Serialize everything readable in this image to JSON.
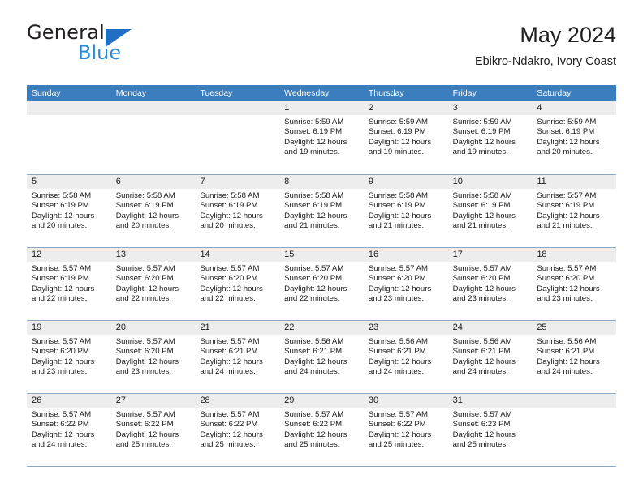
{
  "brand": {
    "line1": "General",
    "line2": "Blue",
    "triangle_color": "#1f6fc4",
    "blue_text_color": "#2b8ad6"
  },
  "header": {
    "title": "May 2024",
    "subtitle": "Ebikro-Ndakro, Ivory Coast"
  },
  "theme": {
    "header_bg": "#3b7ebf",
    "header_text": "#ffffff",
    "daynum_bg": "#ededed",
    "grid_line": "#8aa8c4",
    "page_bg": "#ffffff",
    "text": "#1a1a1a"
  },
  "weekdays": [
    "Sunday",
    "Monday",
    "Tuesday",
    "Wednesday",
    "Thursday",
    "Friday",
    "Saturday"
  ],
  "weeks": [
    [
      {
        "day": "",
        "empty": true
      },
      {
        "day": "",
        "empty": true
      },
      {
        "day": "",
        "empty": true
      },
      {
        "day": "1",
        "sunrise": "Sunrise: 5:59 AM",
        "sunset": "Sunset: 6:19 PM",
        "daylight": "Daylight: 12 hours and 19 minutes."
      },
      {
        "day": "2",
        "sunrise": "Sunrise: 5:59 AM",
        "sunset": "Sunset: 6:19 PM",
        "daylight": "Daylight: 12 hours and 19 minutes."
      },
      {
        "day": "3",
        "sunrise": "Sunrise: 5:59 AM",
        "sunset": "Sunset: 6:19 PM",
        "daylight": "Daylight: 12 hours and 19 minutes."
      },
      {
        "day": "4",
        "sunrise": "Sunrise: 5:59 AM",
        "sunset": "Sunset: 6:19 PM",
        "daylight": "Daylight: 12 hours and 20 minutes."
      }
    ],
    [
      {
        "day": "5",
        "sunrise": "Sunrise: 5:58 AM",
        "sunset": "Sunset: 6:19 PM",
        "daylight": "Daylight: 12 hours and 20 minutes."
      },
      {
        "day": "6",
        "sunrise": "Sunrise: 5:58 AM",
        "sunset": "Sunset: 6:19 PM",
        "daylight": "Daylight: 12 hours and 20 minutes."
      },
      {
        "day": "7",
        "sunrise": "Sunrise: 5:58 AM",
        "sunset": "Sunset: 6:19 PM",
        "daylight": "Daylight: 12 hours and 20 minutes."
      },
      {
        "day": "8",
        "sunrise": "Sunrise: 5:58 AM",
        "sunset": "Sunset: 6:19 PM",
        "daylight": "Daylight: 12 hours and 21 minutes."
      },
      {
        "day": "9",
        "sunrise": "Sunrise: 5:58 AM",
        "sunset": "Sunset: 6:19 PM",
        "daylight": "Daylight: 12 hours and 21 minutes."
      },
      {
        "day": "10",
        "sunrise": "Sunrise: 5:58 AM",
        "sunset": "Sunset: 6:19 PM",
        "daylight": "Daylight: 12 hours and 21 minutes."
      },
      {
        "day": "11",
        "sunrise": "Sunrise: 5:57 AM",
        "sunset": "Sunset: 6:19 PM",
        "daylight": "Daylight: 12 hours and 21 minutes."
      }
    ],
    [
      {
        "day": "12",
        "sunrise": "Sunrise: 5:57 AM",
        "sunset": "Sunset: 6:19 PM",
        "daylight": "Daylight: 12 hours and 22 minutes."
      },
      {
        "day": "13",
        "sunrise": "Sunrise: 5:57 AM",
        "sunset": "Sunset: 6:20 PM",
        "daylight": "Daylight: 12 hours and 22 minutes."
      },
      {
        "day": "14",
        "sunrise": "Sunrise: 5:57 AM",
        "sunset": "Sunset: 6:20 PM",
        "daylight": "Daylight: 12 hours and 22 minutes."
      },
      {
        "day": "15",
        "sunrise": "Sunrise: 5:57 AM",
        "sunset": "Sunset: 6:20 PM",
        "daylight": "Daylight: 12 hours and 22 minutes."
      },
      {
        "day": "16",
        "sunrise": "Sunrise: 5:57 AM",
        "sunset": "Sunset: 6:20 PM",
        "daylight": "Daylight: 12 hours and 23 minutes."
      },
      {
        "day": "17",
        "sunrise": "Sunrise: 5:57 AM",
        "sunset": "Sunset: 6:20 PM",
        "daylight": "Daylight: 12 hours and 23 minutes."
      },
      {
        "day": "18",
        "sunrise": "Sunrise: 5:57 AM",
        "sunset": "Sunset: 6:20 PM",
        "daylight": "Daylight: 12 hours and 23 minutes."
      }
    ],
    [
      {
        "day": "19",
        "sunrise": "Sunrise: 5:57 AM",
        "sunset": "Sunset: 6:20 PM",
        "daylight": "Daylight: 12 hours and 23 minutes."
      },
      {
        "day": "20",
        "sunrise": "Sunrise: 5:57 AM",
        "sunset": "Sunset: 6:20 PM",
        "daylight": "Daylight: 12 hours and 23 minutes."
      },
      {
        "day": "21",
        "sunrise": "Sunrise: 5:57 AM",
        "sunset": "Sunset: 6:21 PM",
        "daylight": "Daylight: 12 hours and 24 minutes."
      },
      {
        "day": "22",
        "sunrise": "Sunrise: 5:56 AM",
        "sunset": "Sunset: 6:21 PM",
        "daylight": "Daylight: 12 hours and 24 minutes."
      },
      {
        "day": "23",
        "sunrise": "Sunrise: 5:56 AM",
        "sunset": "Sunset: 6:21 PM",
        "daylight": "Daylight: 12 hours and 24 minutes."
      },
      {
        "day": "24",
        "sunrise": "Sunrise: 5:56 AM",
        "sunset": "Sunset: 6:21 PM",
        "daylight": "Daylight: 12 hours and 24 minutes."
      },
      {
        "day": "25",
        "sunrise": "Sunrise: 5:56 AM",
        "sunset": "Sunset: 6:21 PM",
        "daylight": "Daylight: 12 hours and 24 minutes."
      }
    ],
    [
      {
        "day": "26",
        "sunrise": "Sunrise: 5:57 AM",
        "sunset": "Sunset: 6:22 PM",
        "daylight": "Daylight: 12 hours and 24 minutes."
      },
      {
        "day": "27",
        "sunrise": "Sunrise: 5:57 AM",
        "sunset": "Sunset: 6:22 PM",
        "daylight": "Daylight: 12 hours and 25 minutes."
      },
      {
        "day": "28",
        "sunrise": "Sunrise: 5:57 AM",
        "sunset": "Sunset: 6:22 PM",
        "daylight": "Daylight: 12 hours and 25 minutes."
      },
      {
        "day": "29",
        "sunrise": "Sunrise: 5:57 AM",
        "sunset": "Sunset: 6:22 PM",
        "daylight": "Daylight: 12 hours and 25 minutes."
      },
      {
        "day": "30",
        "sunrise": "Sunrise: 5:57 AM",
        "sunset": "Sunset: 6:22 PM",
        "daylight": "Daylight: 12 hours and 25 minutes."
      },
      {
        "day": "31",
        "sunrise": "Sunrise: 5:57 AM",
        "sunset": "Sunset: 6:23 PM",
        "daylight": "Daylight: 12 hours and 25 minutes."
      },
      {
        "day": "",
        "empty": true
      }
    ]
  ]
}
